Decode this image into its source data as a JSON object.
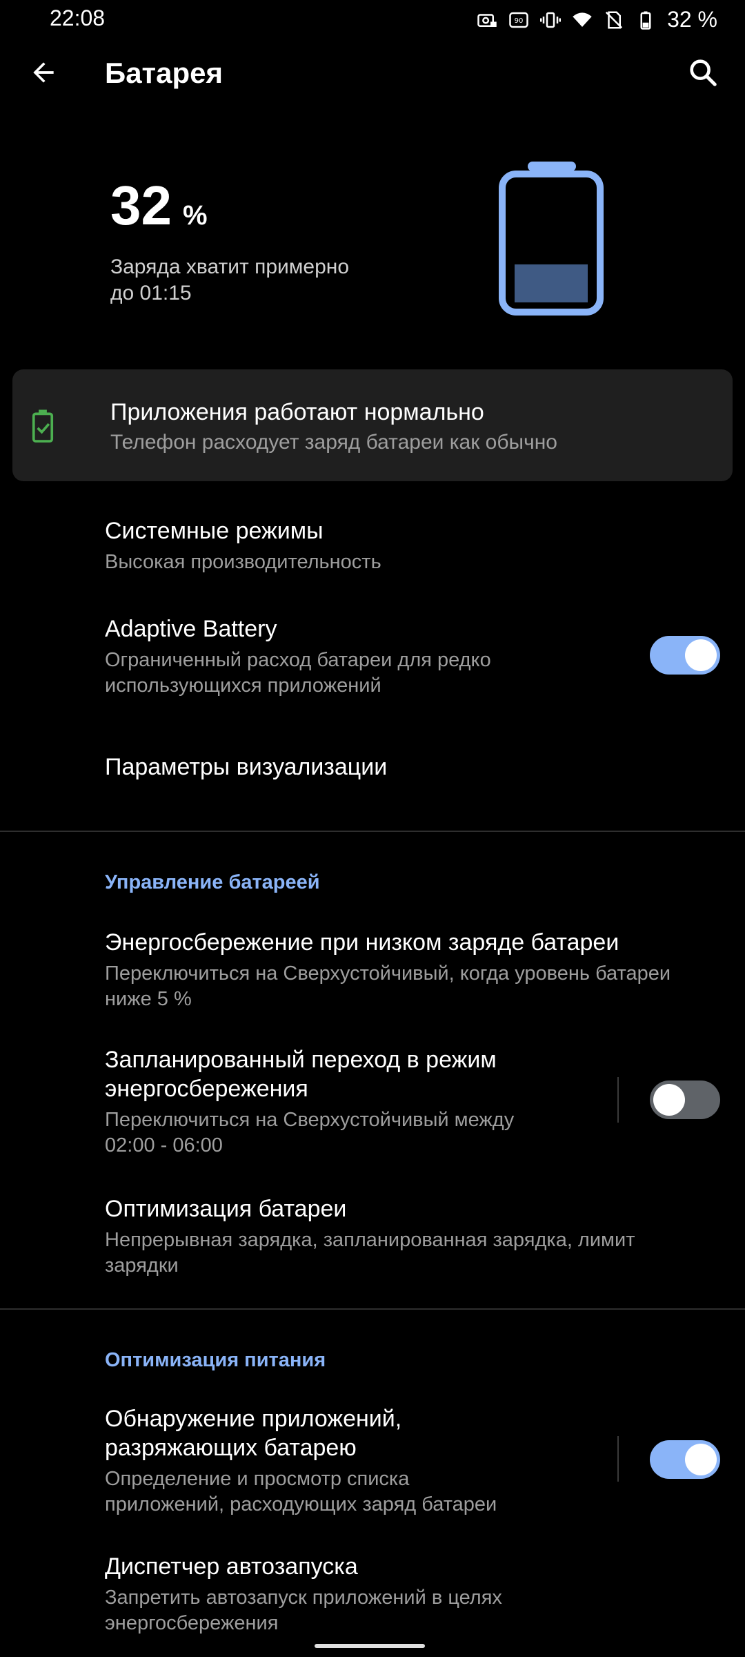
{
  "status": {
    "time": "22:08",
    "battery_text": "32 %"
  },
  "header": {
    "title": "Батарея"
  },
  "battery": {
    "percent": "32",
    "percent_sign": "%",
    "level": 0.32,
    "estimate_line1": "Заряда хватит примерно",
    "estimate_line2": "до 01:15",
    "accent": "#8ab4f8",
    "fill": "#3f5a84"
  },
  "status_card": {
    "title": "Приложения работают нормально",
    "subtitle": "Телефон расходует заряд батареи как обычно",
    "icon_color": "#4caf50"
  },
  "items": {
    "system_modes": {
      "title": "Системные режимы",
      "subtitle": "Высокая производительность"
    },
    "adaptive_battery": {
      "title": "Adaptive Battery",
      "subtitle_line1": "Ограниченный расход батареи для редко",
      "subtitle_line2": "использующихся приложений",
      "enabled": true
    },
    "visualization": {
      "title": "Параметры визуализации"
    },
    "low_battery_saver": {
      "title": "Энергосбережение при низком заряде батареи",
      "subtitle_line1": "Переключиться на Сверхустойчивый, когда уровень батареи",
      "subtitle_line2": "ниже 5 %"
    },
    "scheduled_saver": {
      "title_line1": "Запланированный переход в режим",
      "title_line2": "энергосбережения",
      "subtitle_line1": "Переключиться на Сверхустойчивый между",
      "subtitle_line2": "02:00 - 06:00",
      "enabled": false
    },
    "battery_optimization": {
      "title": "Оптимизация батареи",
      "subtitle_line1": "Непрерывная зарядка, запланированная зарядка, лимит",
      "subtitle_line2": "зарядки"
    },
    "drain_detection": {
      "title_line1": "Обнаружение приложений,",
      "title_line2": "разряжающих батарею",
      "subtitle_line1": "Определение и просмотр списка",
      "subtitle_line2": "приложений, расходующих заряд батареи",
      "enabled": true
    },
    "autostart": {
      "title": "Диспетчер автозапуска",
      "subtitle_line1": "Запретить автозапуск приложений в целях",
      "subtitle_line2": "энергосбережения"
    }
  },
  "sections": {
    "battery_management": "Управление батареей",
    "power_optimization": "Оптимизация питания"
  }
}
